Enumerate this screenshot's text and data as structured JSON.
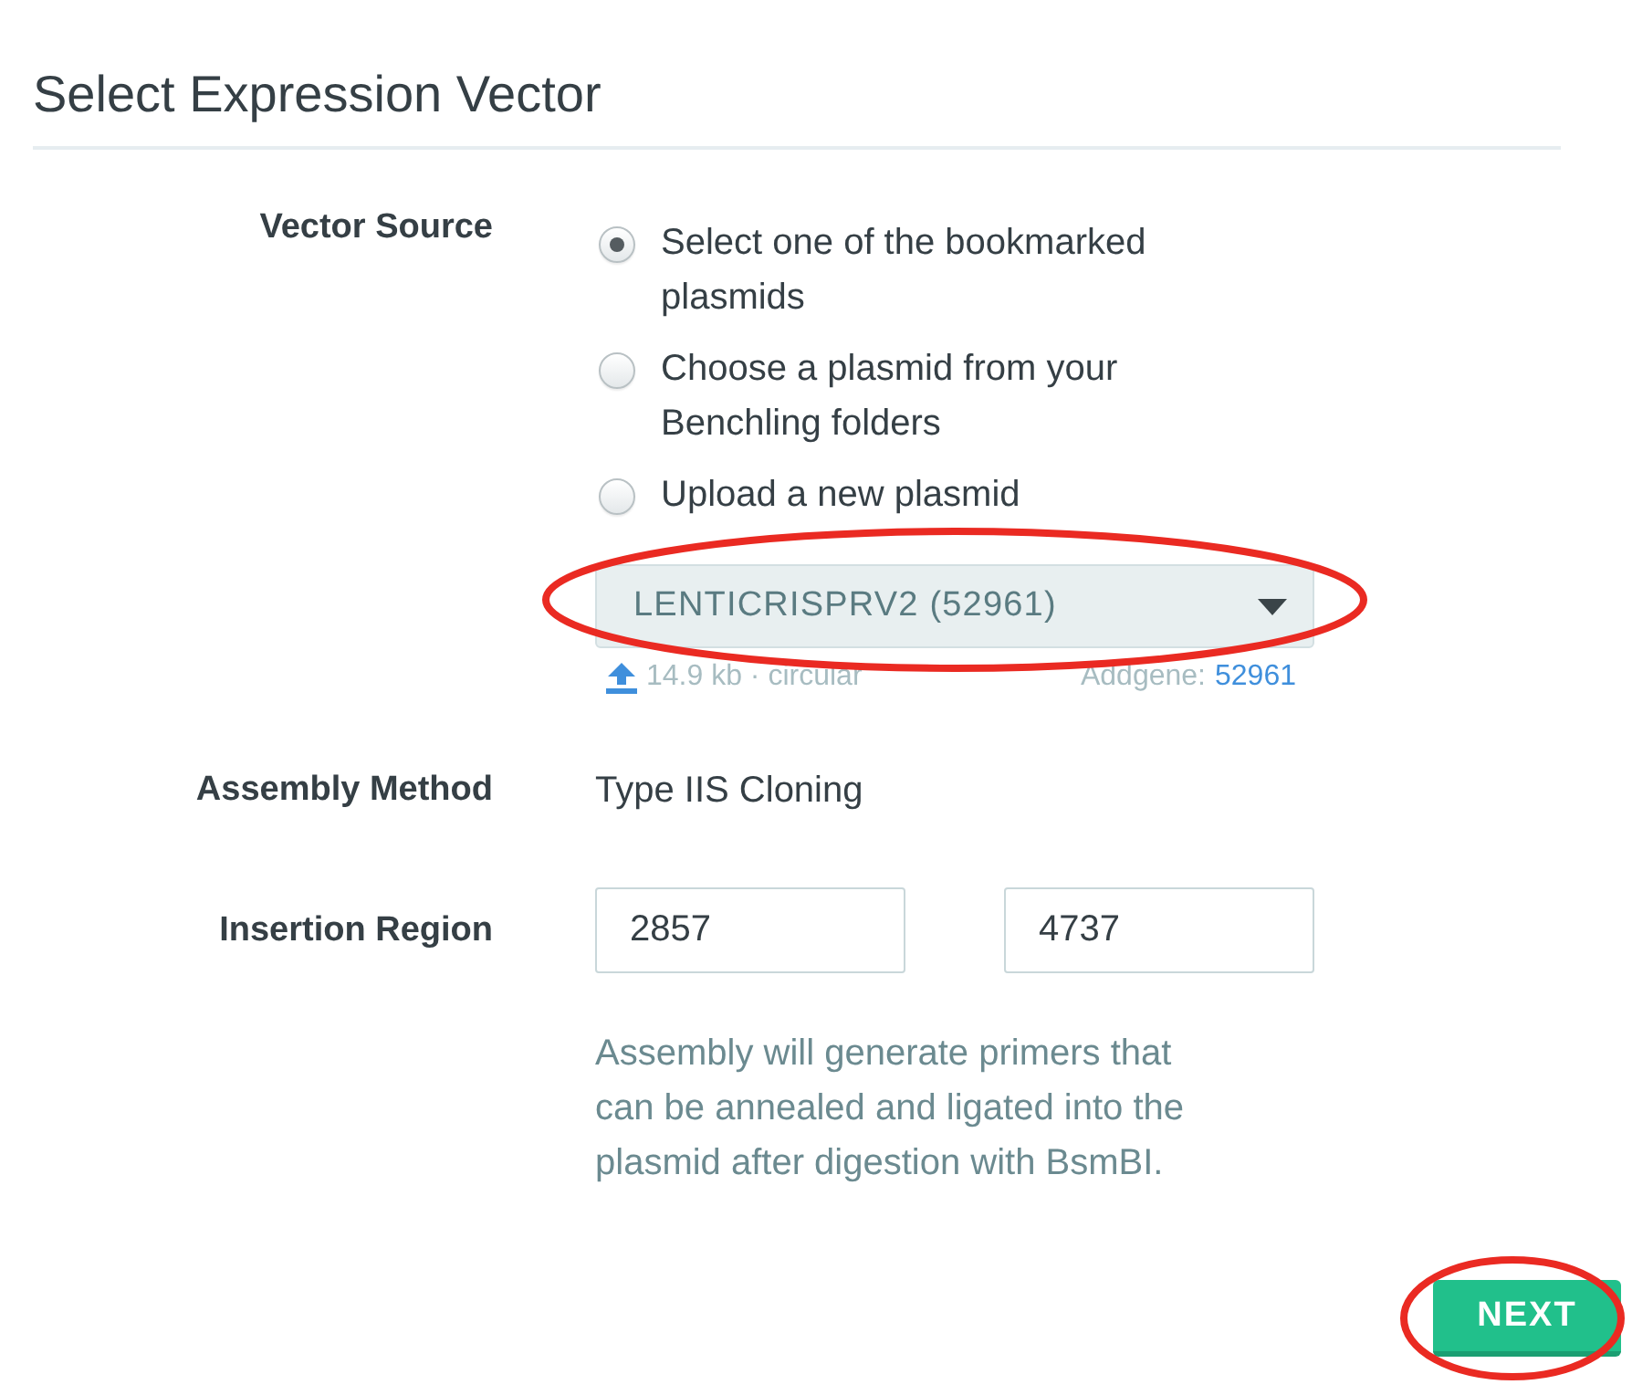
{
  "title": "Select Expression Vector",
  "vector_source": {
    "label": "Vector Source",
    "options": [
      {
        "label": "Select one of the bookmarked plasmids",
        "selected": true
      },
      {
        "label": "Choose a plasmid from your Benchling folders",
        "selected": false
      },
      {
        "label": "Upload a new plasmid",
        "selected": false
      }
    ],
    "plasmid_select": {
      "value": "LENTICRISPRV2 (52961)"
    },
    "plasmid_info": {
      "size": "14.9 kb · circular",
      "source_label": "Addgene:",
      "source_link": "52961"
    }
  },
  "assembly_method": {
    "label": "Assembly Method",
    "value": "Type IIS Cloning"
  },
  "insertion_region": {
    "label": "Insertion Region",
    "start": "2857",
    "end": "4737",
    "help": "Assembly will generate primers that can be annealed and ligated into the plasmid after digestion with BsmBI."
  },
  "next_button": {
    "label": "NEXT"
  }
}
